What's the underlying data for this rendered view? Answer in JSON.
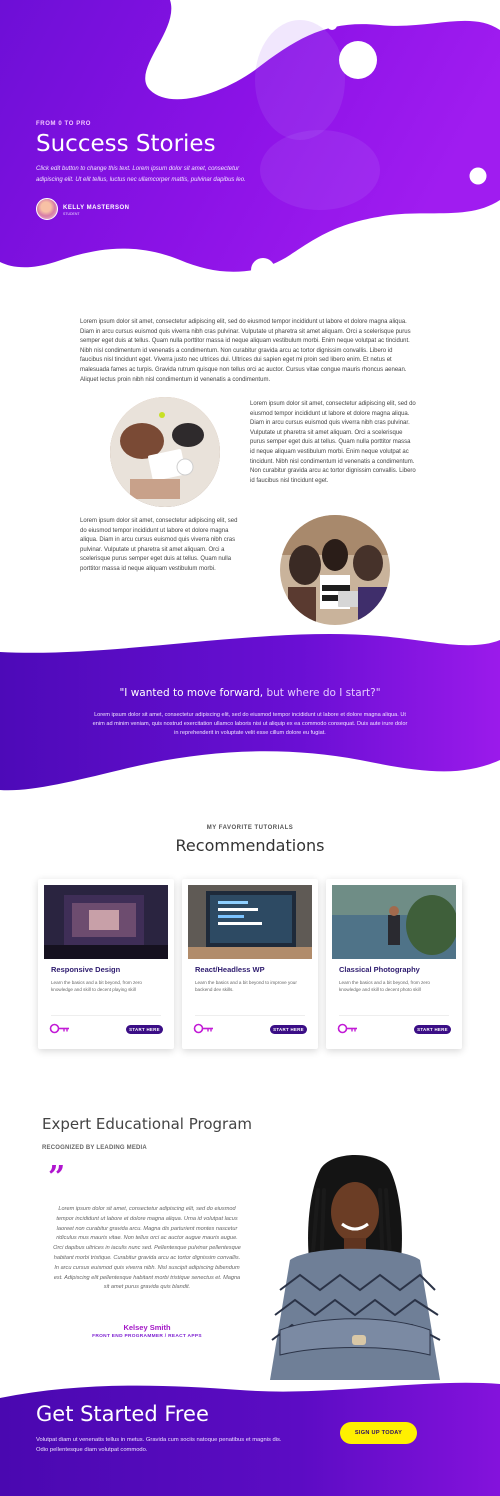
{
  "colors": {
    "purple_dark": "#4a06b3",
    "purple_mid": "#8a0fe6",
    "purple_light": "#b51ef0",
    "cta_yellow": "#fff000",
    "button_navy": "#3b0e86"
  },
  "hero": {
    "eyebrow": "FROM 0 TO PRO",
    "title": "Success Stories",
    "description": "Click edit button to change this text. Lorem ipsum dolor sit amet, consectetur adipiscing elit. Ut elit tellus, luctus nec ullamcorper mattis, pulvinar dapibus leo.",
    "author_name": "KELLY MASTERSON",
    "author_role": "STUDENT"
  },
  "article": {
    "intro": "Lorem ipsum dolor sit amet, consectetur adipiscing elit, sed do eiusmod tempor incididunt ut labore et dolore magna aliqua. Diam in arcu cursus euismod quis viverra nibh cras pulvinar. Vulputate ut pharetra sit amet aliquam. Orci a scelerisque purus semper eget duis at tellus. Quam nulla porttitor massa id neque aliquam vestibulum morbi. Enim neque volutpat ac tincidunt. Nibh nisl condimentum id venenatis a condimentum. Non curabitur gravida arcu ac tortor dignissim convallis. Libero id faucibus nisl tincidunt eget. Viverra justo nec ultrices dui. Ultrices dui sapien eget mi proin sed libero enim. Et netus et malesuada fames ac turpis. Gravida rutrum quisque non tellus orci ac auctor. Cursus vitae congue mauris rhoncus aenean. Aliquet lectus proin nibh nisl condimentum id venenatis a condimentum.",
    "right_para": "Lorem ipsum dolor sit amet, consectetur adipiscing elit, sed do eiusmod tempor incididunt ut labore et dolore magna aliqua. Diam in arcu cursus euismod quis viverra nibh cras pulvinar. Vulputate ut pharetra sit amet aliquam. Orci a scelerisque purus semper eget duis at tellus. Quam nulla porttitor massa id neque aliquam vestibulum morbi. Enim neque volutpat ac tincidunt. Nibh nisl condimentum id venenatis a condimentum. Non curabitur gravida arcu ac tortor dignissim convallis. Libero id faucibus nisl tincidunt eget.",
    "left_para": "Lorem ipsum dolor sit amet, consectetur adipiscing elit, sed do eiusmod tempor incididunt ut labore et dolore magna aliqua. Diam in arcu cursus euismod quis viverra nibh cras pulvinar. Vulputate ut pharetra sit amet aliquam. Orci a scelerisque purus semper eget duis at tellus. Quam nulla porttitor massa id neque aliquam vestibulum morbi."
  },
  "quote_section": {
    "quote_bold": "\"I wanted to move forward,",
    "quote_light": " but where do I start?\"",
    "body": "Lorem ipsum dolor sit amet, consectetur adipiscing elit, sed do eiusmod tempor incididunt ut labore et dolore magna aliqua. Ut enim ad minim veniam, quis nostrud exercitation ullamco laboris nisi ut aliquip ex ea commodo consequat. Duis aute irure dolor in reprehenderit in voluptate velit esse cillum dolore eu fugiat."
  },
  "recommendations": {
    "eyebrow": "MY FAVORITE TUTORIALS",
    "title": "Recommendations",
    "cards": [
      {
        "title": "Responsive Design",
        "description": "Learn the basics and a bit beyond, from zero knowledge and skill to decent playing skill",
        "button": "START HERE",
        "icon": "key-icon"
      },
      {
        "title": "React/Headless WP",
        "description": "Learn the basics and a bit beyond to improve your backend dev skills.",
        "button": "START HERE",
        "icon": "key-icon"
      },
      {
        "title": "Classical Photography",
        "description": "Learn the basics and a bit beyond, from zero knowledge and skill to decent photo skill",
        "button": "START HERE",
        "icon": "key-icon"
      }
    ]
  },
  "expert": {
    "title": "Expert Educational Program",
    "eyebrow": "RECOGNIZED BY LEADING MEDIA",
    "quote_mark": "”",
    "testimonial": "Lorem ipsum dolor sit amet, consectetur adipiscing elit, sed do eiusmod tempor incididunt ut labore et dolore magna aliqua. Urna id volutpat lacus laoreet non curabitur gravida arcu. Magna dis parturient montes nascetur ridiculus mus mauris vitae. Non tellus orci ac auctor augue mauris augue. Orci dapibus ultrices in iaculis nunc sed. Pellentesque pulvinar pellentesque habitant morbi tristique. Curabitur gravida arcu ac tortor dignissim convallis. In arcu cursus euismod quis viverra nibh. Nisl suscipit adipiscing bibendum est. Adipiscing elit pellentesque habitant morbi tristique senectus et. Magna sit amet purus gravida quis blandit.",
    "name": "Kelsey Smith",
    "role": "FRONT END PROGRAMMER / REACT APPS"
  },
  "cta": {
    "title": "Get Started Free",
    "description": "Volutpat diam ut venenatis tellus in metus. Gravida cum sociis natoque penatibus et magnis dis. Odio pellentesque diam volutpat commodo.",
    "button": "SIGN UP TODAY"
  }
}
